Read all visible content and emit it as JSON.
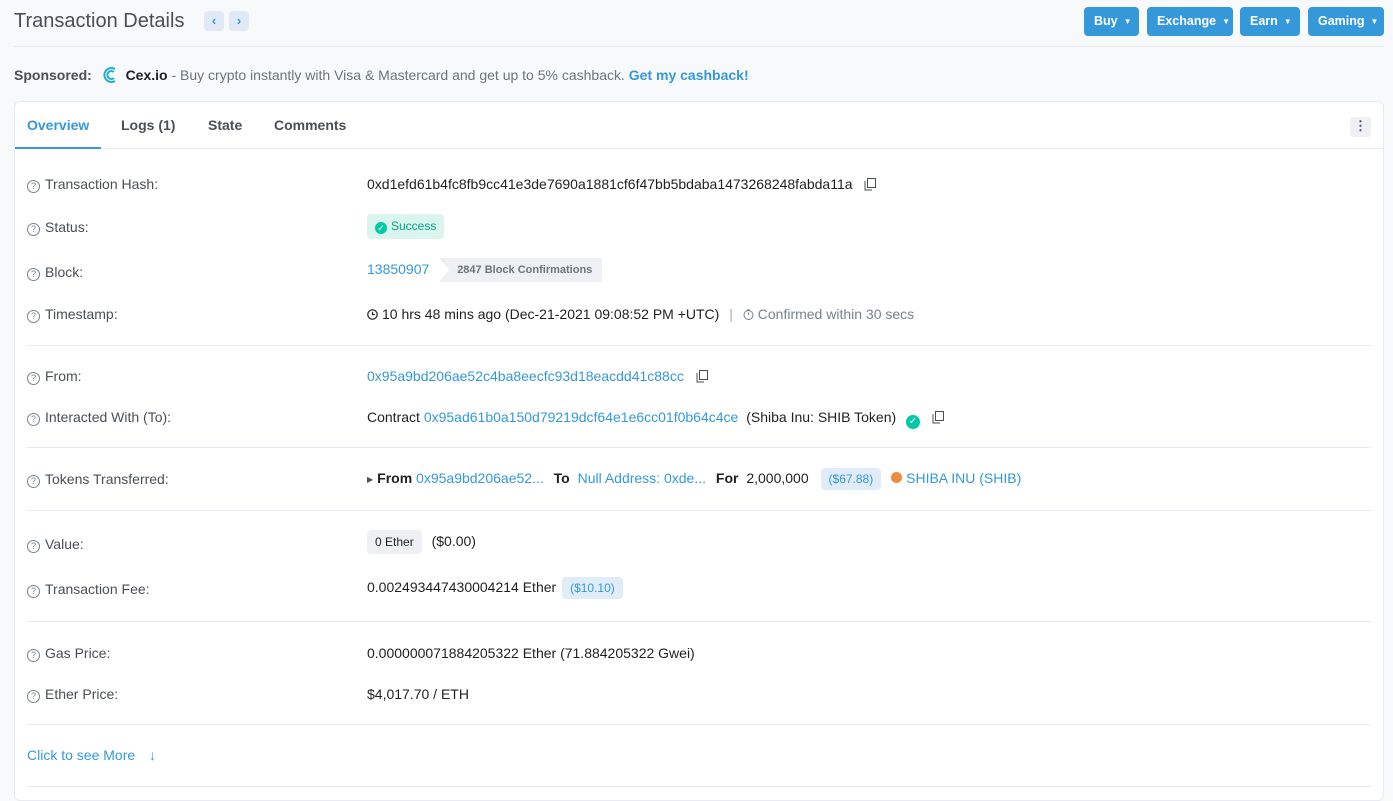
{
  "header": {
    "title": "Transaction Details",
    "prev_icon": "chevron-left-icon",
    "next_icon": "chevron-right-icon",
    "buttons": [
      "Buy",
      "Exchange",
      "Earn",
      "Gaming"
    ]
  },
  "sponsored": {
    "label": "Sponsored:",
    "brand": "Cex.io",
    "text": "- Buy crypto instantly with Visa & Mastercard and get up to 5% cashback.",
    "cta": "Get my cashback!"
  },
  "tabs": [
    "Overview",
    "Logs (1)",
    "State",
    "Comments"
  ],
  "more_icon": "⋮",
  "overview": {
    "tx_hash": {
      "label": "Transaction Hash:",
      "value": "0xd1efd61b4fc8fb9cc41e3de7690a1881cf6f47bb5bdaba1473268248fabda11a"
    },
    "status": {
      "label": "Status:",
      "value": "Success"
    },
    "block": {
      "label": "Block:",
      "value": "13850907",
      "confirmations": "2847 Block Confirmations"
    },
    "timestamp": {
      "label": "Timestamp:",
      "value": "10 hrs 48 mins ago (Dec-21-2021 09:08:52 PM +UTC)",
      "confirmed": "Confirmed within 30 secs"
    },
    "from": {
      "label": "From:",
      "value": "0x95a9bd206ae52c4ba8eecfc93d18eacdd41c88cc"
    },
    "to": {
      "label": "Interacted With (To):",
      "prefix": "Contract",
      "address": "0x95ad61b0a150d79219dcf64e1e6cc01f0b64c4ce",
      "name": "(Shiba Inu: SHIB Token)"
    },
    "tokens": {
      "label": "Tokens Transferred:",
      "from_label": "From",
      "from": "0x95a9bd206ae52...",
      "to_label": "To",
      "to": "Null Address: 0xde...",
      "for_label": "For",
      "amount": "2,000,000",
      "usd": "($67.88)",
      "token": "SHIBA INU (SHIB)"
    },
    "value": {
      "label": "Value:",
      "ether": "0 Ether",
      "usd": "($0.00)"
    },
    "fee": {
      "label": "Transaction Fee:",
      "value": "0.002493447430004214 Ether",
      "usd": "($10.10)"
    },
    "gas_price": {
      "label": "Gas Price:",
      "value": "0.000000071884205322 Ether (71.884205322 Gwei)"
    },
    "ether_price": {
      "label": "Ether Price:",
      "value": "$4,017.70 / ETH"
    }
  },
  "see_more": "Click to see More",
  "colors": {
    "accent": "#3498db",
    "success": "#00c9a7",
    "background": "#f8f9fa"
  }
}
